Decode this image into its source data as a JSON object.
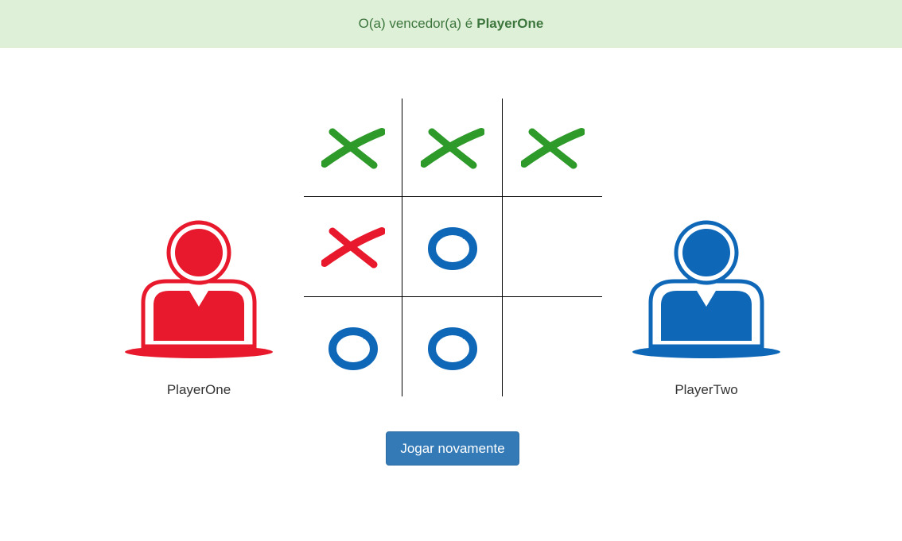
{
  "banner": {
    "prefix": "O(a) vencedor(a) é",
    "winner": "PlayerOne",
    "color": "#3c763d",
    "background": "#dff0d8"
  },
  "players": {
    "one": {
      "name": "PlayerOne",
      "color": "#e8192c",
      "icon": "person-icon"
    },
    "two": {
      "name": "PlayerTwo",
      "color": "#0f67b8",
      "icon": "person-icon"
    }
  },
  "board": {
    "cells": [
      "X-green",
      "X-green",
      "X-green",
      "X-red",
      "O-blue",
      "",
      "O-blue",
      "O-blue",
      ""
    ],
    "colors": {
      "green": "#2e9a2a",
      "red": "#e8192c",
      "blue": "#0f67b8"
    }
  },
  "actions": {
    "play_again_label": "Jogar novamente",
    "button_color": "#337ab7"
  }
}
